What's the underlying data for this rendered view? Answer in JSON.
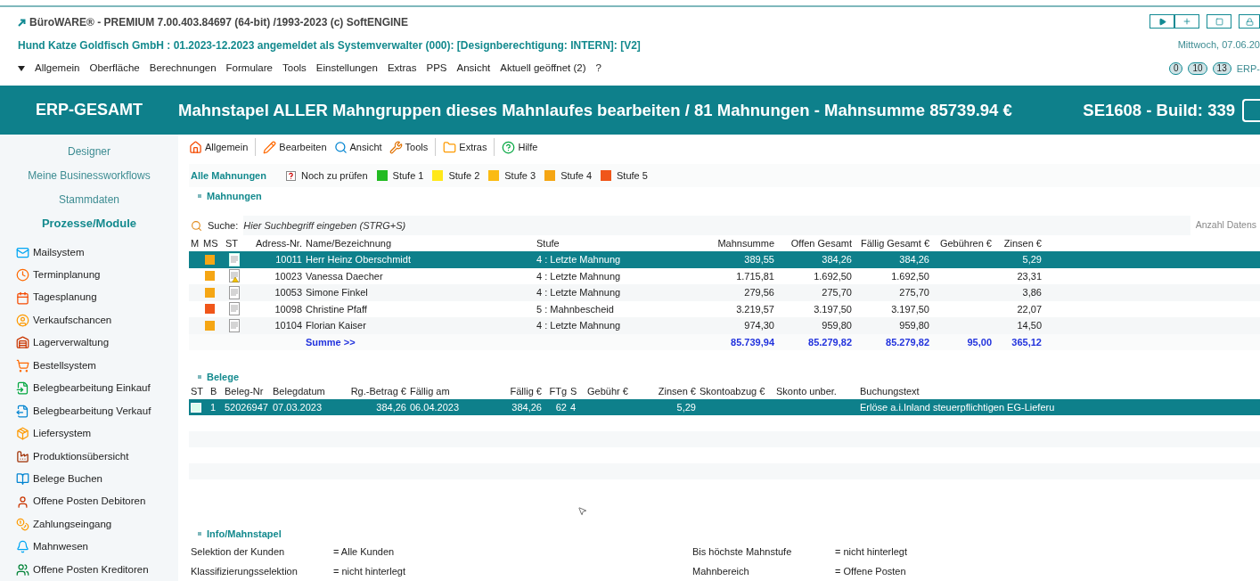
{
  "title_bar": {
    "app_title": "BüroWARE® - PREMIUM  7.00.403.84697 (64-bit) /1993-2023 (c) SoftENGINE",
    "company_line": "Hund Katze Goldfisch GmbH : 01.2023-12.2023 angemeldet als Systemverwalter (000): [Designberechtigung: INTERN]: [V2]",
    "date_text": "Mittwoch, 07.06.20",
    "counters": [
      "0",
      "10",
      "13"
    ],
    "erp_text": "ERP-"
  },
  "menu": [
    "Allgemein",
    "Oberfläche",
    "Berechnungen",
    "Formulare",
    "Tools",
    "Einstellungen",
    "Extras",
    "PPS",
    "Ansicht",
    "Aktuell geöffnet (2)",
    "?"
  ],
  "banner": {
    "module": "ERP-GESAMT",
    "title": "Mahnstapel ALLER Mahngruppen dieses Mahnlaufes bearbeiten / 81 Mahnungen - Mahnsumme 85739.94 €",
    "build": "SE1608 - Build: 339"
  },
  "sidebar": {
    "links": [
      {
        "label": "Designer",
        "selected": false
      },
      {
        "label": "Meine Businessworkflows",
        "selected": false
      },
      {
        "label": "Stammdaten",
        "selected": false
      },
      {
        "label": "Prozesse/Module",
        "selected": true
      }
    ],
    "modules": [
      "Mailsystem",
      "Terminplanung",
      "Tagesplanung",
      "Verkaufschancen",
      "Lagerverwaltung",
      "Bestellsystem",
      "Belegbearbeitung Einkauf",
      "Belegbearbeitung Verkauf",
      "Liefersystem",
      "Produktionsübersicht",
      "Belege Buchen",
      "Offene Posten Debitoren",
      "Zahlungseingang",
      "Mahnwesen",
      "Offene Posten Kreditoren"
    ]
  },
  "toolbar": [
    "Allgemein",
    "Bearbeiten",
    "Ansicht",
    "Tools",
    "Extras",
    "Hilfe"
  ],
  "filter_tabs": [
    {
      "label": "Alle Mahnungen",
      "kind": "tab",
      "selected": true
    },
    {
      "label": "Noch zu prüfen",
      "kind": "check",
      "selected": false
    },
    {
      "label": "Stufe 1",
      "kind": "level",
      "selected": false,
      "color": "#22bb22"
    },
    {
      "label": "Stufe 2",
      "kind": "level",
      "selected": false,
      "color": "#ffe81a"
    },
    {
      "label": "Stufe 3",
      "kind": "level",
      "selected": false,
      "color": "#fbbb12"
    },
    {
      "label": "Stufe 4",
      "kind": "level",
      "selected": false,
      "color": "#f5a614"
    },
    {
      "label": "Stufe 5",
      "kind": "level",
      "selected": false,
      "color": "#f0561a"
    }
  ],
  "mahnungen": {
    "title": "Mahnungen",
    "search_label": "Suche:",
    "search_placeholder": "Hier Suchbegriff eingeben (STRG+S)",
    "count_label": "Anzahl Datens",
    "columns": [
      "M",
      "MS",
      "ST",
      "Adress-Nr.",
      "Name/Bezeichnung",
      "Stufe",
      "Mahnsumme",
      "Offen Gesamt",
      "Fällig Gesamt €",
      "Gebühren €",
      "Zinsen €"
    ],
    "rows": [
      {
        "selected": true,
        "color": "#f5a614",
        "warning": false,
        "adress_nr": "10011",
        "name": "Herr Heinz Oberschmidt",
        "stufe": "4 : Letzte Mahnung",
        "mahnsumme": "389,55",
        "offen": "384,26",
        "faellig": "384,26",
        "zinsen": "5,29"
      },
      {
        "selected": false,
        "color": "#f5a614",
        "warning": true,
        "adress_nr": "10023",
        "name": "Vanessa Daecher",
        "stufe": "4 : Letzte Mahnung",
        "mahnsumme": "1.715,81",
        "offen": "1.692,50",
        "faellig": "1.692,50",
        "zinsen": "23,31"
      },
      {
        "selected": false,
        "color": "#f5a614",
        "warning": false,
        "adress_nr": "10053",
        "name": "Simone Finkel",
        "stufe": "4 : Letzte Mahnung",
        "mahnsumme": "279,56",
        "offen": "275,70",
        "faellig": "275,70",
        "zinsen": "3,86"
      },
      {
        "selected": false,
        "color": "#f0561a",
        "warning": false,
        "adress_nr": "10098",
        "name": "Christine Pfaff",
        "stufe": "5 : Mahnbescheid",
        "mahnsumme": "3.219,57",
        "offen": "3.197,50",
        "faellig": "3.197,50",
        "zinsen": "22,07"
      },
      {
        "selected": false,
        "color": "#f5a614",
        "warning": false,
        "adress_nr": "10104",
        "name": "Florian Kaiser",
        "stufe": "4 : Letzte Mahnung",
        "mahnsumme": "974,30",
        "offen": "959,80",
        "faellig": "959,80",
        "zinsen": "14,50"
      }
    ],
    "summe": {
      "label": "Summe >>",
      "mahnsumme": "85.739,94",
      "offen": "85.279,82",
      "faellig": "85.279,82",
      "gebuehren": "95,00",
      "zinsen": "365,12"
    }
  },
  "belege": {
    "title": "Belege",
    "columns": [
      "ST",
      "B",
      "Beleg-Nr",
      "Belegdatum",
      "Rg.-Betrag €",
      "Fällig am",
      "Fällig €",
      "FTg",
      "S",
      "Gebühr €",
      "Zinsen €",
      "Skontoabzug €",
      "Skonto unber.",
      "Buchungstext"
    ],
    "rows": [
      {
        "selected": true,
        "cells": [
          "",
          "1",
          "52026947",
          "07.03.2023",
          "384,26",
          "06.04.2023",
          "384,26",
          "62",
          "4",
          "",
          "5,29",
          "",
          "",
          "Erlöse a.i.Inland steuerpflichtigen EG-Lieferu"
        ]
      }
    ]
  },
  "info": {
    "title": "Info/Mahnstapel",
    "rows": [
      {
        "label": "Selektion der Kunden",
        "value": "= Alle Kunden",
        "label2": "Bis höchste Mahnstufe",
        "value2": "= nicht hinterlegt"
      },
      {
        "label": "Klassifizierungsselektion",
        "value": "= nicht hinterlegt",
        "label2": "Mahnbereich",
        "value2": "= Offene Posten"
      }
    ]
  }
}
